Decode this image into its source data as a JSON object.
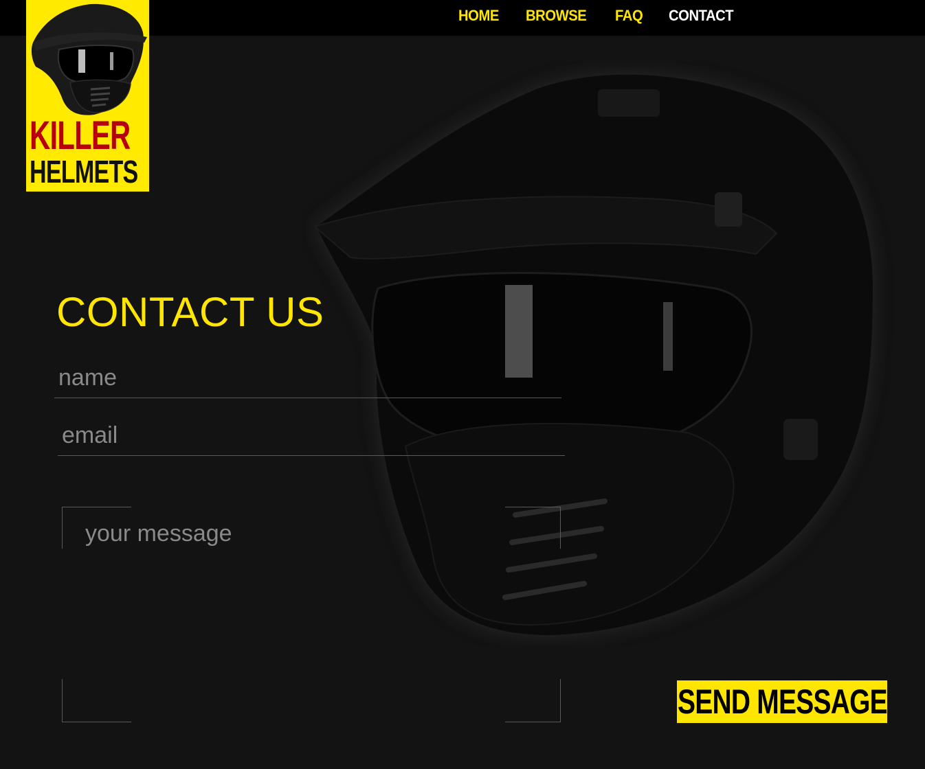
{
  "brand": {
    "line1": "KILLER",
    "line2": "HELMETS",
    "colors": {
      "accent": "#ffe600",
      "logo_red": "#b8000d",
      "background": "#131313"
    }
  },
  "nav": {
    "items": [
      {
        "label": "HOME",
        "active": false
      },
      {
        "label": "BROWSE",
        "active": false
      },
      {
        "label": "FAQ",
        "active": false
      },
      {
        "label": "CONTACT",
        "active": true
      }
    ]
  },
  "form": {
    "heading": "CONTACT US",
    "name_placeholder": "name",
    "email_placeholder": "email",
    "message_placeholder": "your message",
    "send_label": "SEND MESSAGE"
  },
  "icons": [
    "helmet-logo-icon",
    "background-helmet-image"
  ]
}
